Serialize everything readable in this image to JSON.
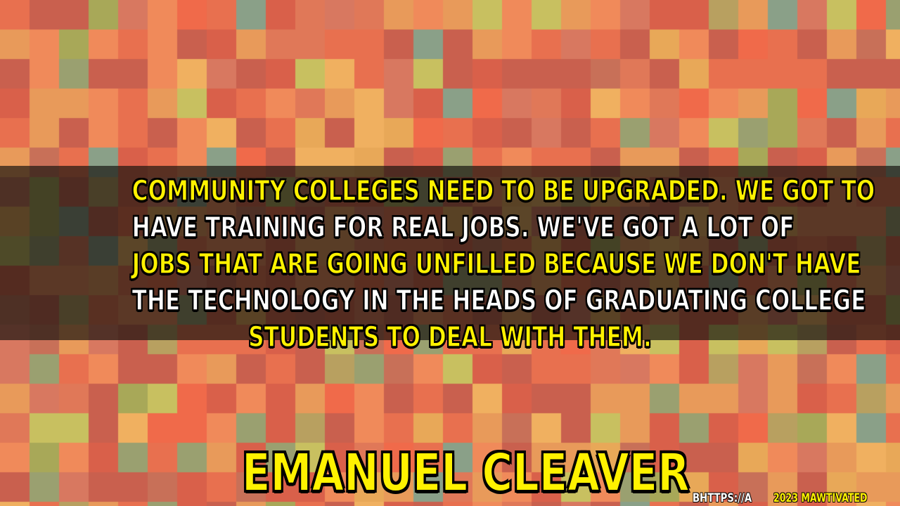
{
  "background": {
    "description_free": true,
    "palette": [
      "#e8704f",
      "#f08a5a",
      "#d9604a",
      "#c9604e",
      "#e89a5a",
      "#b8a060",
      "#9aa070",
      "#8aa088",
      "#c8c060",
      "#e8a858",
      "#d87860",
      "#f06a4a",
      "#a8a858",
      "#c87058",
      "#e07858",
      "#f0b060"
    ]
  },
  "quote": {
    "lines": [
      {
        "text": "COMMUNITY COLLEGES NEED TO BE UPGRADED. WE GOT TO",
        "color": "#fff200"
      },
      {
        "text": "HAVE TRAINING FOR REAL JOBS. WE'VE GOT A LOT OF",
        "color": "#ffffff"
      },
      {
        "text": "JOBS THAT ARE GOING UNFILLED BECAUSE WE DON'T HAVE",
        "color": "#fff200"
      },
      {
        "text": "THE TECHNOLOGY IN THE HEADS OF GRADUATING COLLEGE",
        "color": "#ffffff"
      },
      {
        "text": "STUDENTS TO DEAL WITH THEM.",
        "color": "#fff200"
      }
    ]
  },
  "author": {
    "name": "EMANUEL CLEAVER",
    "color": "#fff200"
  },
  "footer": {
    "url": "BHTTPS://A",
    "copyright": "2023 MAWTIVATED"
  }
}
